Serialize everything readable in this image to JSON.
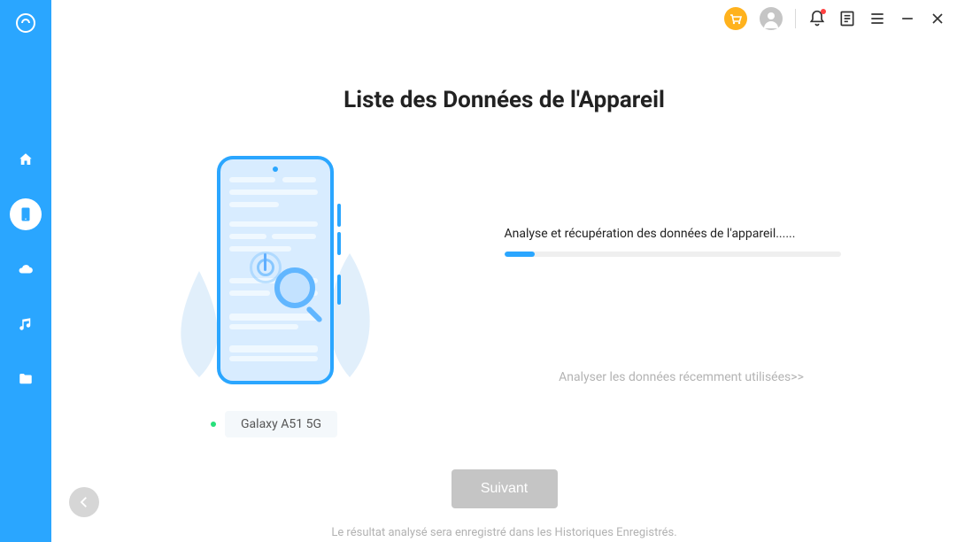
{
  "sidebar": {
    "items": [
      {
        "icon": "logo",
        "active": false
      },
      {
        "icon": "home",
        "active": false
      },
      {
        "icon": "device",
        "active": true
      },
      {
        "icon": "cloud",
        "active": false
      },
      {
        "icon": "music",
        "active": false
      },
      {
        "icon": "folder",
        "active": false
      }
    ]
  },
  "titlebar": {
    "icons": [
      "cart",
      "user",
      "bell",
      "note",
      "menu",
      "minimize",
      "close"
    ]
  },
  "colors": {
    "accent": "#2aa6ff",
    "cart_bg": "#ffb21d",
    "status_green": "#27e07b"
  },
  "page": {
    "title": "Liste des Données de l'Appareil",
    "status_text": "Analyse et récupération des données de l'appareil......",
    "progress_percent": 9,
    "recent_link": "Analyser les données récemment utilisées>>",
    "next_label": "Suivant",
    "footer": "Le résultat analysé sera enregistré dans les Historiques Enregistrés."
  },
  "device": {
    "name": "Galaxy A51 5G",
    "status": "connected"
  }
}
